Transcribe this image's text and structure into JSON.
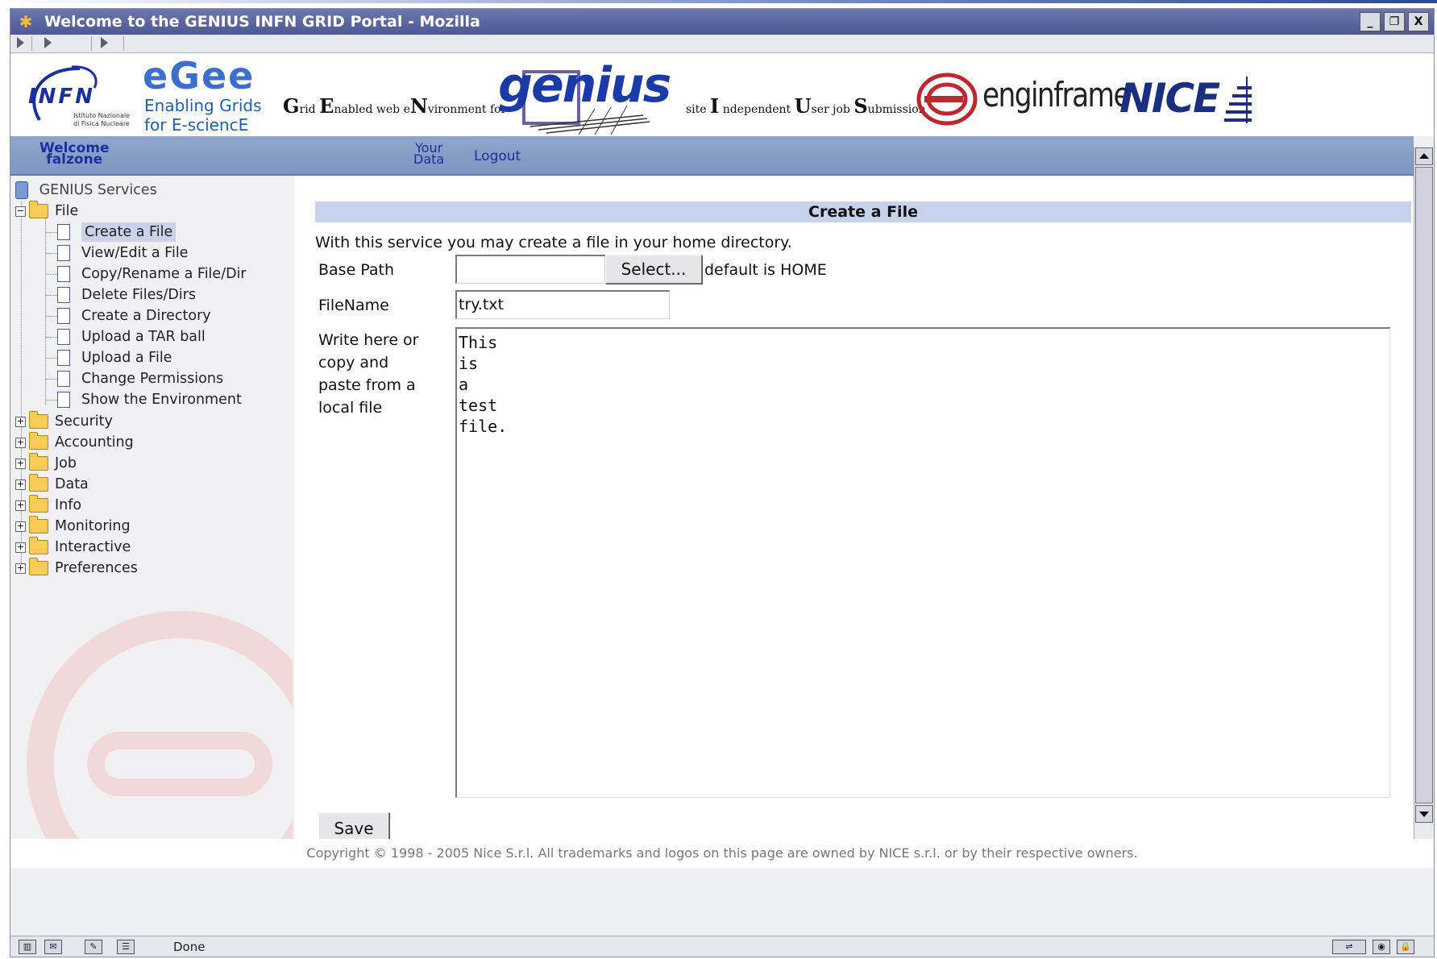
{
  "window": {
    "title": "Welcome to the GENIUS INFN GRID Portal - Mozilla",
    "controls": [
      "_",
      "❐",
      "X"
    ]
  },
  "header": {
    "infn": {
      "name": "INFN",
      "sub1": "Istituto Nazionale",
      "sub2": "di Fisica Nucleare"
    },
    "egee": {
      "name": "eGee",
      "line1": "Enabling Grids",
      "line2": "for E-sciencE"
    },
    "genius_expansion": [
      "G",
      "rid ",
      "E",
      "nabled web e",
      "N",
      "vironment for"
    ],
    "genius": "genius",
    "iuser_expansion": [
      "site ",
      "I",
      " ndependent ",
      "U",
      "ser job ",
      "S",
      "ubmission"
    ],
    "enginframe": "enginframe",
    "nice": "NICE"
  },
  "nav": {
    "welcome_line1": "Welcome",
    "welcome_line2": "falzone",
    "yourdata_line1": "Your",
    "yourdata_line2": "Data",
    "logout": "Logout"
  },
  "tree": {
    "root": "GENIUS Services",
    "file_folder": "File",
    "file_items": [
      "Create a File",
      "View/Edit a File",
      "Copy/Rename a File/Dir",
      "Delete Files/Dirs",
      "Create a Directory",
      "Upload a TAR ball",
      "Upload a File",
      "Change Permissions",
      "Show the Environment"
    ],
    "selected_item": "Create a File",
    "folders": [
      "Security",
      "Accounting",
      "Job",
      "Data",
      "Info",
      "Monitoring",
      "Interactive",
      "Preferences"
    ]
  },
  "form": {
    "title": "Create a File",
    "intro": "With this service you may create a file in your home directory.",
    "base_path_label": "Base Path",
    "base_path_value": "",
    "select_button": "Select...",
    "default_note": "default is HOME",
    "filename_label": "FileName",
    "filename_value": "try.txt",
    "content_label_lines": [
      "Write here or",
      "copy and",
      "paste from a",
      "local file"
    ],
    "content_value": "This\nis\na\ntest\nfile.",
    "save_button": "Save"
  },
  "footer": {
    "copyright": "Copyright © 1998 - 2005 Nice S.r.l. All trademarks and logos on this page are owned by NICE s.r.l. or by their respective owners."
  },
  "status": {
    "text": "Done"
  },
  "colors": {
    "titlebar": "#5a64a2",
    "nav": "#87a0c8",
    "link": "#1a2fa0",
    "section_header": "#c6d3ea"
  }
}
